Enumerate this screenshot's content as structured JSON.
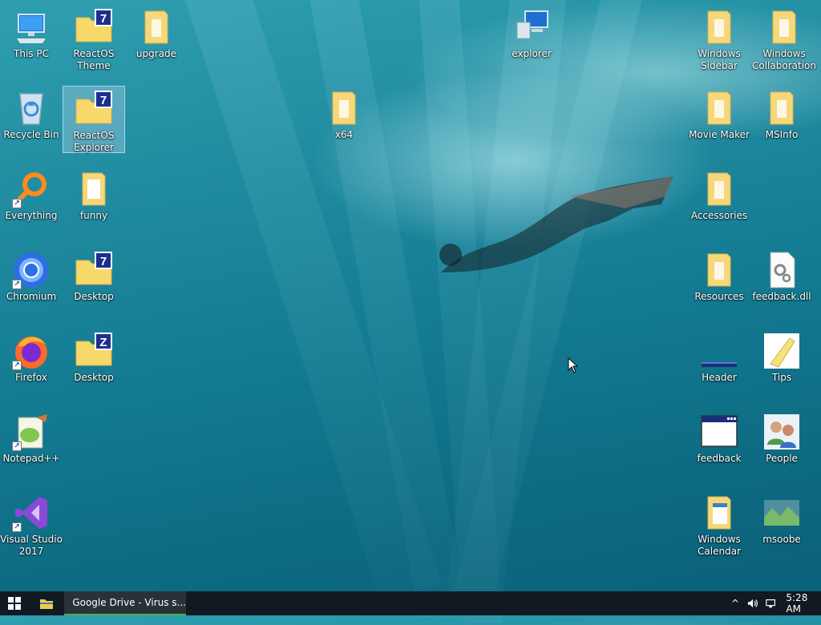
{
  "desktop": {
    "icons": {
      "this_pc": "This PC",
      "reactos_theme": "ReactOS\nTheme",
      "upgrade": "upgrade",
      "explorer": "explorer",
      "windows_sidebar": "Windows\nSidebar",
      "windows_collaboration": "Windows\nCollaboration",
      "recycle_bin": "Recycle Bin",
      "reactos_explorer": "ReactOS\nExplorer",
      "x64": "x64",
      "movie_maker": "Movie Maker",
      "msinfo": "MSInfo",
      "everything": "Everything",
      "funny": "funny",
      "accessories": "Accessories",
      "chromium": "Chromium",
      "desktop7": "Desktop",
      "resources": "Resources",
      "feedback_dll": "feedback.dll",
      "firefox": "Firefox",
      "desktopz": "Desktop",
      "header": "Header",
      "tips": "Tips",
      "notepadpp": "Notepad++",
      "feedback": "feedback",
      "people": "People",
      "visual_studio": "Visual Studio\n2017",
      "windows_calendar": "Windows\nCalendar",
      "msoobe": "msoobe"
    },
    "selected_icon": "ReactOS Explorer"
  },
  "taskbar": {
    "active_app_title": "Google Drive - Virus s...",
    "clock": "5:28 AM",
    "accent_color": "#4fb04f"
  },
  "icon_names": [
    "computer-icon",
    "folder-icon",
    "recycle-bin-icon",
    "magnifier-icon",
    "chromium-icon",
    "firefox-icon",
    "notepadpp-icon",
    "visual-studio-icon",
    "dll-file-icon",
    "tips-icon",
    "people-icon",
    "window-icon",
    "calendar-folder-icon",
    "image-icon"
  ]
}
